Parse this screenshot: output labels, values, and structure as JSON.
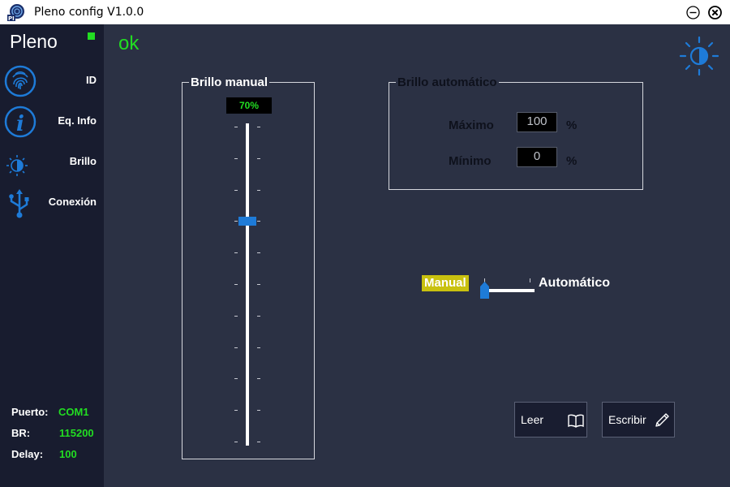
{
  "window": {
    "title": "Pleno config V1.0.0"
  },
  "sidebar": {
    "brand": "Pleno",
    "items": [
      {
        "label": "ID",
        "icon": "fingerprint-icon"
      },
      {
        "label": "Eq. Info",
        "icon": "info-icon"
      },
      {
        "label": "Brillo",
        "icon": "brightness-icon"
      },
      {
        "label": "Conexión",
        "icon": "usb-icon"
      }
    ],
    "connection": {
      "port_label": "Puerto:",
      "port_value": "COM1",
      "br_label": "BR:",
      "br_value": "115200",
      "delay_label": "Delay:",
      "delay_value": "100"
    }
  },
  "status": {
    "text": "ok"
  },
  "manual_brightness": {
    "title": "Brillo manual",
    "value_text": "70%",
    "level": 0.7
  },
  "auto_brightness": {
    "title": "Brillo automático",
    "max_label": "Máximo",
    "max_value": "100",
    "max_unit": "%",
    "min_label": "Mínimo",
    "min_value": "0",
    "min_unit": "%"
  },
  "mode_toggle": {
    "manual_label": "Manual",
    "auto_label": "Automático",
    "selected": "Manual"
  },
  "buttons": {
    "read_label": "Leer",
    "write_label": "Escribir"
  },
  "colors": {
    "background": "#2b3144",
    "sidebar": "#181c2f",
    "accent_blue": "#1e7bd8",
    "status_green": "#22dd22",
    "manual_highlight": "#c9c10f"
  }
}
